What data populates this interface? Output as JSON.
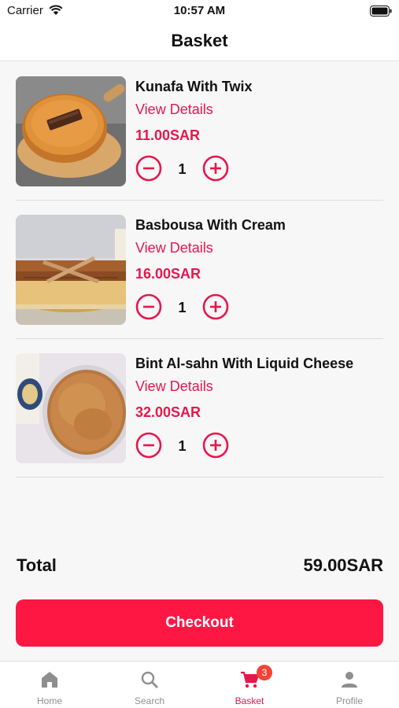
{
  "status_bar": {
    "carrier": "Carrier",
    "time": "10:57 AM"
  },
  "header": {
    "title": "Basket"
  },
  "items": [
    {
      "name": "Kunafa With Twix",
      "details_label": "View Details",
      "price": "11.00SAR",
      "quantity": "1"
    },
    {
      "name": "Basbousa With Cream",
      "details_label": "View Details",
      "price": "16.00SAR",
      "quantity": "1"
    },
    {
      "name": "Bint Al-sahn With Liquid Cheese",
      "details_label": "View Details",
      "price": "32.00SAR",
      "quantity": "1"
    }
  ],
  "summary": {
    "total_label": "Total",
    "total_value": "59.00SAR"
  },
  "checkout": {
    "label": "Checkout"
  },
  "tabs": [
    {
      "label": "Home",
      "icon": "home-icon"
    },
    {
      "label": "Search",
      "icon": "search-icon"
    },
    {
      "label": "Basket",
      "icon": "cart-icon",
      "badge": "3",
      "active": true
    },
    {
      "label": "Profile",
      "icon": "person-icon"
    }
  ],
  "colors": {
    "accent": "#e6174d",
    "button": "#ff1744",
    "badge": "#f44336"
  }
}
